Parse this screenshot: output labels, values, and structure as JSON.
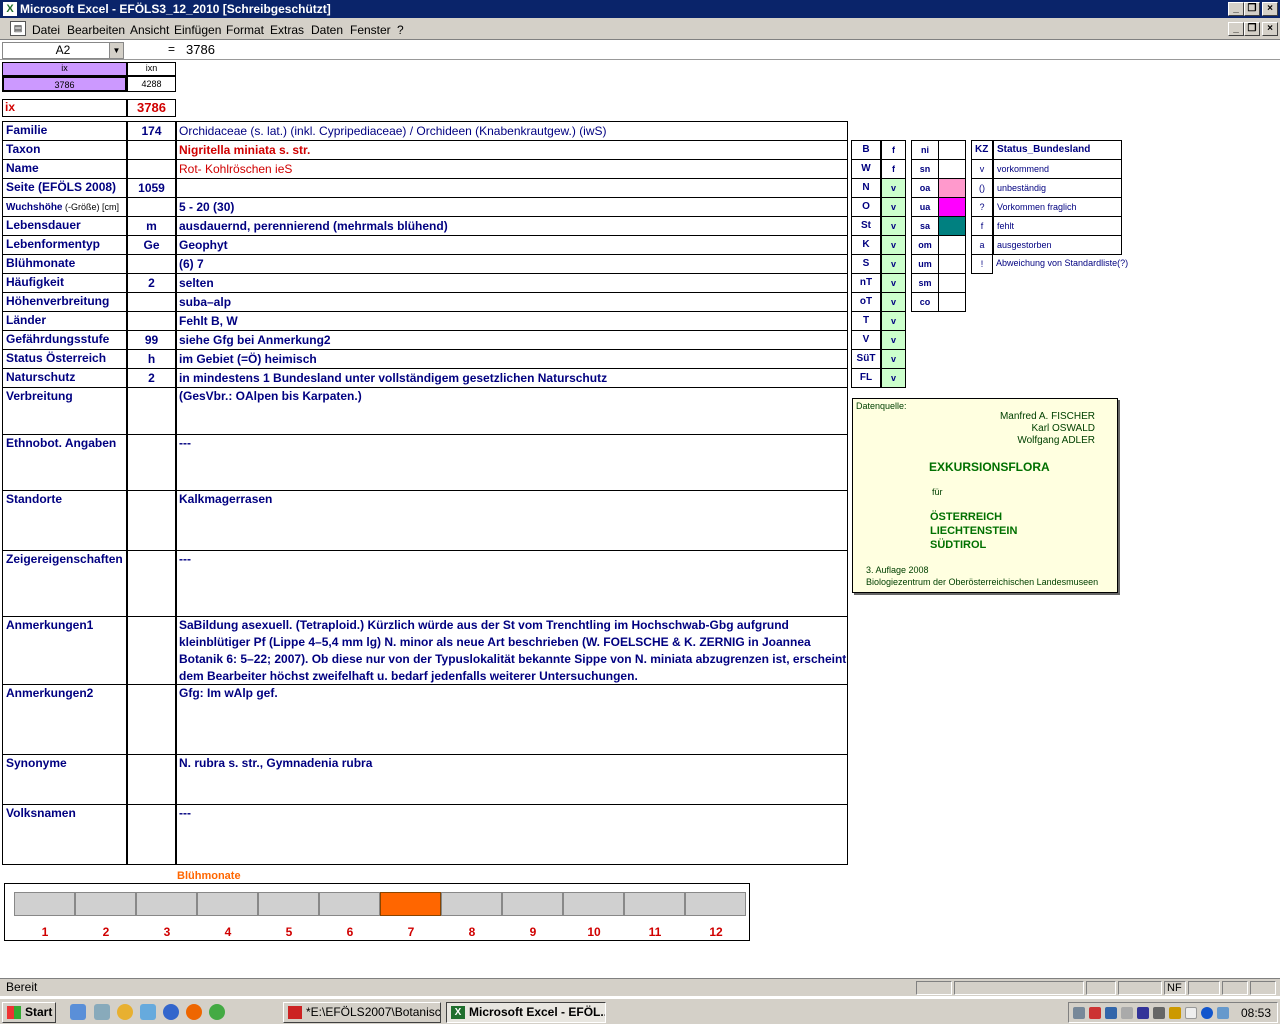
{
  "window": {
    "title": "Microsoft Excel - EFÖLS3_12_2010  [Schreibgeschützt]"
  },
  "menu": [
    "Datei",
    "Bearbeiten",
    "Ansicht",
    "Einfügen",
    "Format",
    "Extras",
    "Daten",
    "Fenster",
    "?"
  ],
  "formula": {
    "namebox": "A2",
    "eq": "=",
    "value": "3786"
  },
  "top": {
    "ix_label": "ix",
    "ixn_label": "ixn",
    "ix_val": "3786",
    "ixn_val": "4288",
    "ix_big_label": "ix",
    "ix_big_val": "3786"
  },
  "rows": [
    {
      "label": "Familie",
      "num": "174",
      "value": "Orchidaceae (s. lat.) (inkl. Cypripediaceae)  /  Orchideen (Knabenkrautgew.) (iwS)"
    },
    {
      "label": "Taxon",
      "num": "",
      "value": "Nigritella miniata s. str."
    },
    {
      "label": "Name",
      "num": "",
      "value": "Rot- Kohlröschen ieS"
    },
    {
      "label": "Seite (EFÖLS 2008)",
      "num": "1059",
      "value": ""
    },
    {
      "label": "Wuchshöhe",
      "label_small": " (-Größe) [cm]",
      "num": "",
      "value": " 5 - 20 (30)"
    },
    {
      "label": "Lebensdauer",
      "num": "m",
      "value": "ausdauernd, perennierend (mehrmals blühend)"
    },
    {
      "label": "Lebenformentyp",
      "num": "Ge",
      "value": "Geophyt"
    },
    {
      "label": "Blühmonate",
      "num": "",
      "value": "(6) 7"
    },
    {
      "label": "Häufigkeit",
      "num": "2",
      "value": "selten"
    },
    {
      "label": "Höhenverbreitung",
      "num": "",
      "value": "suba–alp"
    },
    {
      "label": "Länder",
      "num": "",
      "value": " Fehlt B, W"
    },
    {
      "label": "Gefährdungsstufe",
      "num": "99",
      "value": "siehe Gfg bei Anmerkung2"
    },
    {
      "label": "Status Österreich",
      "num": "h",
      "value": "im Gebiet (=Ö) heimisch"
    },
    {
      "label": "Naturschutz",
      "num": "2",
      "value": "in mindestens 1 Bundesland unter vollständigem gesetzlichen Naturschutz"
    },
    {
      "label": "Verbreitung",
      "num": "",
      "value": "(GesVbr.: OAlpen bis Karpaten.)"
    },
    {
      "label": "Ethnobot. Angaben",
      "num": "",
      "value": "---"
    },
    {
      "label": "Standorte",
      "num": "",
      "value": "Kalkmagerrasen"
    },
    {
      "label": "Zeigereigenschaften",
      "num": "",
      "value": "---"
    },
    {
      "label": "Anmerkungen1",
      "num": "",
      "value": " SaBildung asexuell. (Tetraploid.) Kürzlich würde aus der St vom Trenchtling im Hochschwab-Gbg aufgrund kleinblütiger Pf (Lippe 4–5,4 mm lg) N. minor als neue Art beschrieben (W. FOELSCHE & K. ZERNIG in Joannea Botanik 6: 5–22; 2007). Ob diese nur von der Typuslokalität bekannte Sippe von N. miniata abzugrenzen ist, erscheint dem Bearbeiter höchst zweifelhaft u. bedarf jedenfalls weiterer Untersuchungen."
    },
    {
      "label": "Anmerkungen2",
      "num": "",
      "value": "Gfg:  Im wAlp gef."
    },
    {
      "label": "Synonyme",
      "num": "",
      "value": "N. rubra s. str., Gymnadenia rubra"
    },
    {
      "label": "Volksnamen",
      "num": "",
      "value": "---"
    }
  ],
  "states": [
    {
      "k": "B",
      "v": "f"
    },
    {
      "k": "W",
      "v": "f"
    },
    {
      "k": "N",
      "v": "v"
    },
    {
      "k": "O",
      "v": "v"
    },
    {
      "k": "St",
      "v": "v"
    },
    {
      "k": "K",
      "v": "v"
    },
    {
      "k": "S",
      "v": "v"
    },
    {
      "k": "nT",
      "v": "v"
    },
    {
      "k": "oT",
      "v": "v"
    },
    {
      "k": "T",
      "v": "v"
    },
    {
      "k": "V",
      "v": "v"
    },
    {
      "k": "SüT",
      "v": "v"
    },
    {
      "k": "FL",
      "v": "v"
    }
  ],
  "regions": [
    {
      "k": "ni",
      "color": ""
    },
    {
      "k": "sn",
      "color": ""
    },
    {
      "k": "oa",
      "color": "#ff99cc"
    },
    {
      "k": "ua",
      "color": "#ff00ff"
    },
    {
      "k": "sa",
      "color": "#008080"
    },
    {
      "k": "om",
      "color": ""
    },
    {
      "k": "um",
      "color": ""
    },
    {
      "k": "sm",
      "color": ""
    },
    {
      "k": "co",
      "color": ""
    }
  ],
  "legend": {
    "kz": "KZ",
    "header": "Status_Bundesland",
    "items": [
      {
        "k": "v",
        "t": "vorkommend"
      },
      {
        "k": "()",
        "t": "unbeständig"
      },
      {
        "k": "?",
        "t": "Vorkommen fraglich"
      },
      {
        "k": "f",
        "t": "fehlt"
      },
      {
        "k": "a",
        "t": "ausgestorben"
      },
      {
        "k": "!",
        "t": "Abweichung von Standardliste(?)"
      }
    ]
  },
  "source": {
    "label": "Datenquelle:",
    "a1": "Manfred A. FISCHER",
    "a2": "Karl OSWALD",
    "a3": "Wolfgang ADLER",
    "title": "EXKURSIONSFLORA",
    "fuer": "für",
    "c1": "ÖSTERREICH",
    "c2": "LIECHTENSTEIN",
    "c3": "SÜDTIROL",
    "ed": "3. Auflage 2008",
    "pub": "Biologiezentrum der Oberösterreichischen Landesmuseen"
  },
  "bloom": {
    "title": "Blühmonate",
    "months": [
      "1",
      "2",
      "3",
      "4",
      "5",
      "6",
      "7",
      "8",
      "9",
      "10",
      "11",
      "12"
    ],
    "active": [
      7
    ],
    "active_color": "#ff6600"
  },
  "status": {
    "text": "Bereit",
    "nf": "NF"
  },
  "taskbar": {
    "start": "Start",
    "tasks": [
      "*E:\\EFÖLS2007\\Botanisc...",
      "Microsoft Excel - EFÖL..."
    ],
    "clock": "08:53"
  }
}
